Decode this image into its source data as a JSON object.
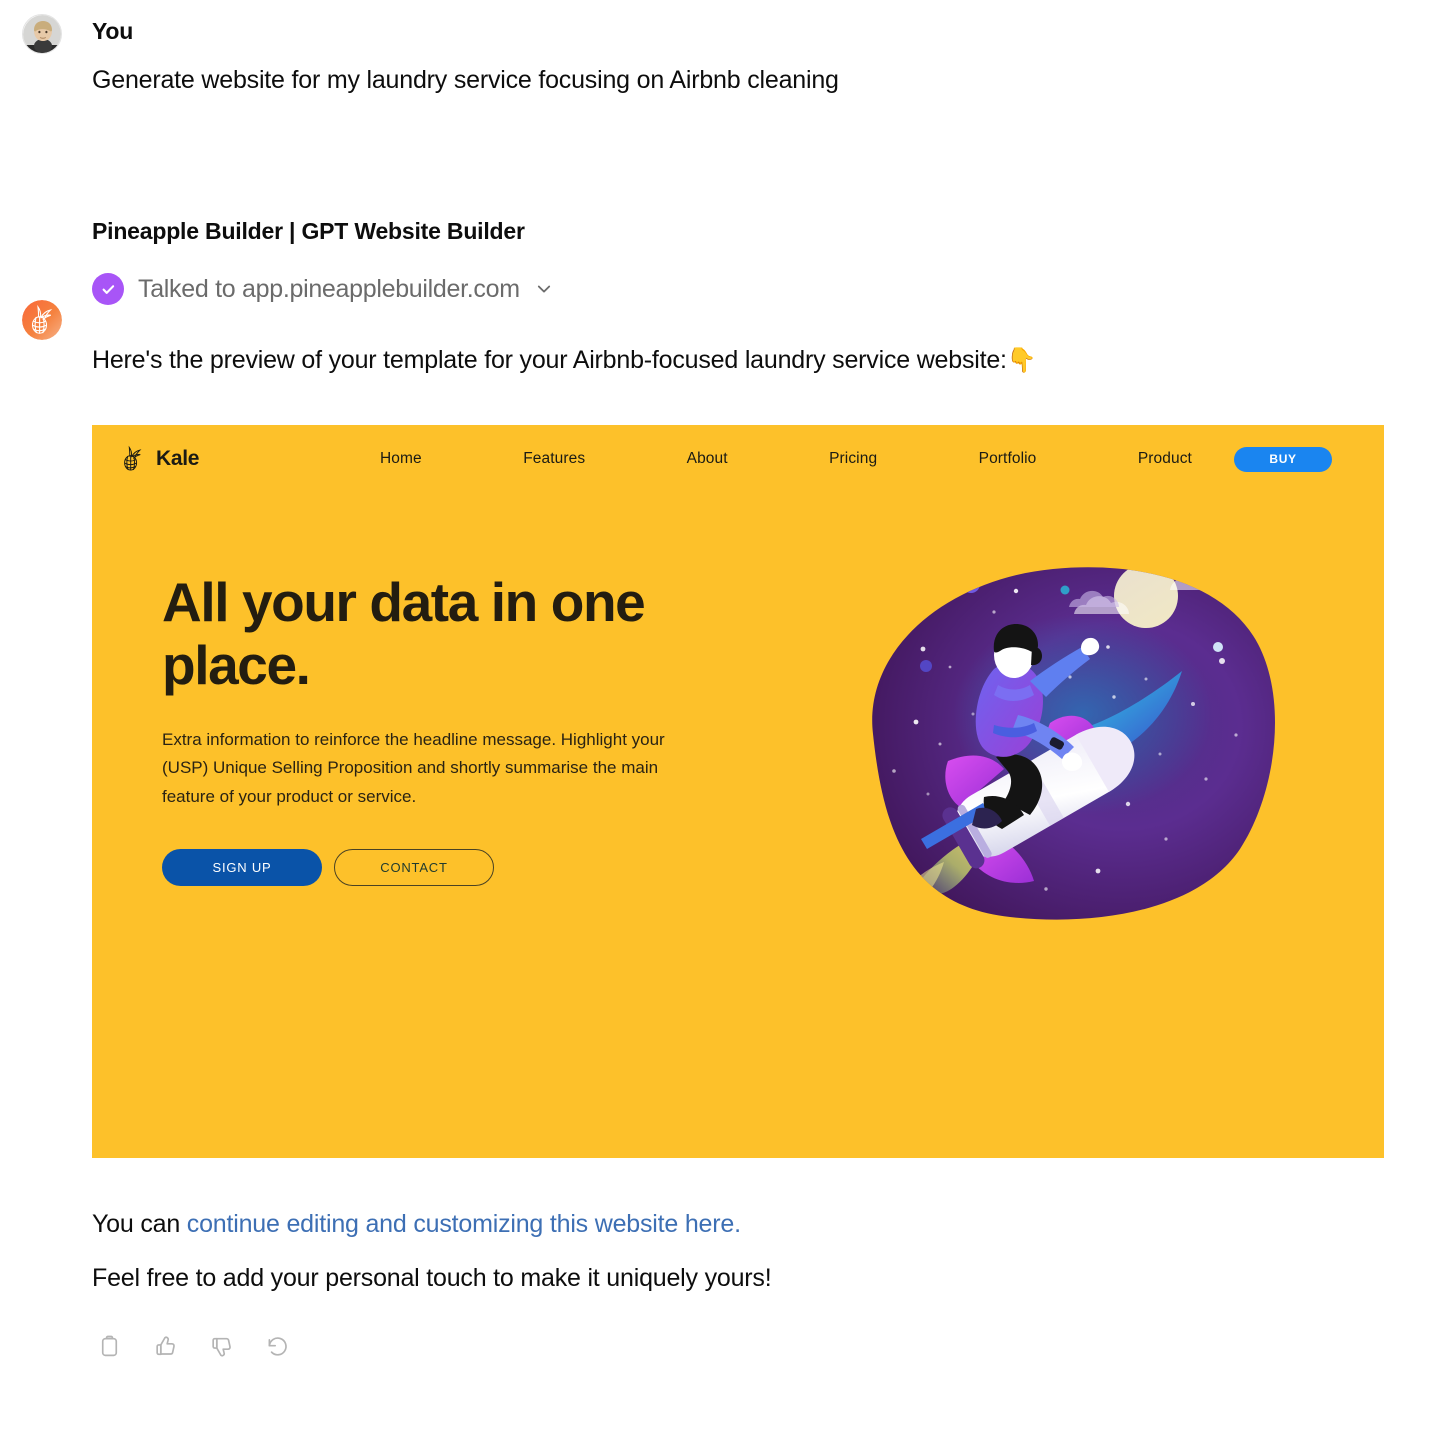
{
  "conversation": {
    "user": {
      "author": "You",
      "avatar_icon": "user-photo-avatar",
      "message": "Generate website for my laundry service focusing on Airbnb cleaning"
    },
    "assistant": {
      "author": "Pineapple Builder | GPT Website Builder",
      "avatar_icon": "pineapple-gpt-avatar",
      "tool_call": {
        "status_icon": "purple-check-icon",
        "label": "Talked to app.pineapplebuilder.com",
        "expand_icon": "chevron-down-icon"
      },
      "intro_text": "Here's the preview of your template for your Airbnb-focused laundry service website:",
      "intro_emoji": "👇",
      "closing_line_1_prefix": "You can ",
      "closing_line_1_link": "continue editing and customizing this website here.",
      "closing_line_2": "Feel free to add your personal touch to make it uniquely yours!"
    },
    "actions": [
      {
        "name": "copy",
        "icon": "clipboard-icon"
      },
      {
        "name": "good-response",
        "icon": "thumbs-up-icon"
      },
      {
        "name": "bad-response",
        "icon": "thumbs-down-icon"
      },
      {
        "name": "regenerate",
        "icon": "regenerate-icon"
      }
    ]
  },
  "preview": {
    "background_color": "#FDC12A",
    "brand": {
      "logo_icon": "pineapple-icon",
      "name": "Kale"
    },
    "nav_links": [
      "Home",
      "Features",
      "About",
      "Pricing",
      "Portfolio",
      "Product"
    ],
    "buy_button": {
      "label": "BUY",
      "color": "#1A85F0"
    },
    "hero": {
      "title": "All your data in one place.",
      "subtitle": "Extra information to reinforce the headline message. Highlight your (USP) Unique Selling Proposition and shortly summarise the main feature of your product or service.",
      "primary_button": {
        "label": "SIGN UP",
        "color": "#0A53A8"
      },
      "secondary_button": {
        "label": "CONTACT"
      },
      "illustration": "astronaut-riding-rocket-illustration"
    }
  }
}
